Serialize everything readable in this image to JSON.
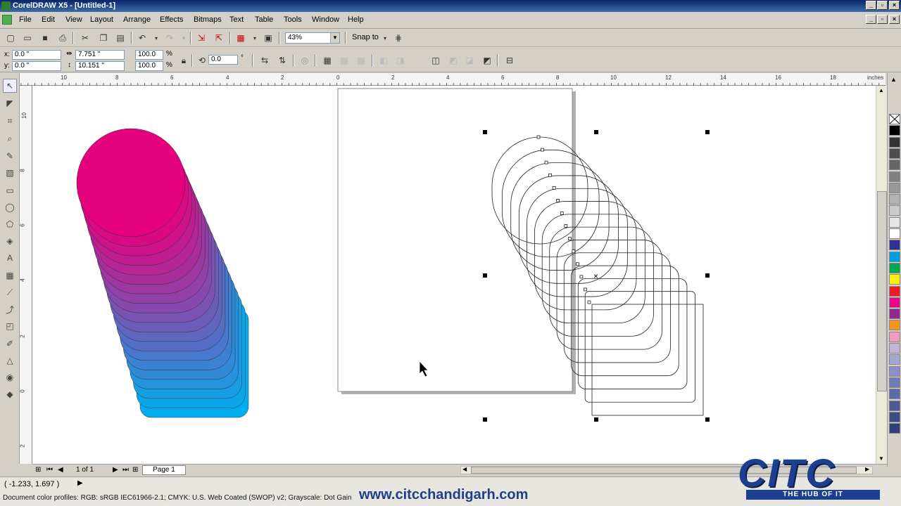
{
  "window": {
    "title": "CorelDRAW X5 - [Untitled-1]"
  },
  "menu": [
    "File",
    "Edit",
    "View",
    "Layout",
    "Arrange",
    "Effects",
    "Bitmaps",
    "Text",
    "Table",
    "Tools",
    "Window",
    "Help"
  ],
  "toolbar": {
    "zoom": "43%",
    "snap_to": "Snap to"
  },
  "property_bar": {
    "x_label": "x:",
    "x_value": "0.0 \"",
    "y_label": "y:",
    "y_value": "0.0 \"",
    "width_value": "7.751 \"",
    "height_value": "10.151 \"",
    "scale_x": "100.0",
    "scale_y": "100.0",
    "percent": "%",
    "rotation": "0.0",
    "degree": "°"
  },
  "ruler": {
    "h_labels": [
      "10",
      "8",
      "6",
      "4",
      "2",
      "0",
      "2",
      "4",
      "6",
      "8",
      "10",
      "12",
      "14",
      "16",
      "18"
    ],
    "units": "inches",
    "v_labels": [
      "10",
      "8",
      "6",
      "4",
      "2",
      "0",
      "2"
    ]
  },
  "page_nav": {
    "page_counter": "1 of 1",
    "page_tab": "Page 1"
  },
  "status": {
    "coords": "( -1.233, 1.697 )",
    "color_profiles": "Document color profiles: RGB: sRGB IEC61966-2.1; CMYK: U.S. Web Coated (SWOP) v2; Grayscale: Dot Gain"
  },
  "overlay": {
    "website": "www.citcchandigarh.com",
    "logo_text": "CITC",
    "logo_tagline": "THE HUB OF IT"
  },
  "palette": [
    "#ffffff",
    "#000000",
    "#333333",
    "#4d4d4d",
    "#666666",
    "#808080",
    "#999999",
    "#b3b3b3",
    "#cccccc",
    "#e6e6e6",
    "#ffffff",
    "#2e3192",
    "#00a0e0",
    "#00a651",
    "#fff200",
    "#ed1c24",
    "#ec008c",
    "#92278f",
    "#f7941d",
    "#f49ac1",
    "#c2b5d8",
    "#a5a6d8",
    "#8a8fc8",
    "#6f7bb8",
    "#5b6aa8",
    "#4c5b98",
    "#3d4d88",
    "#2f3f78"
  ],
  "colors": {
    "blend_start": "#e5007e",
    "blend_end": "#00aeef",
    "title_bar": "#0a246a"
  }
}
